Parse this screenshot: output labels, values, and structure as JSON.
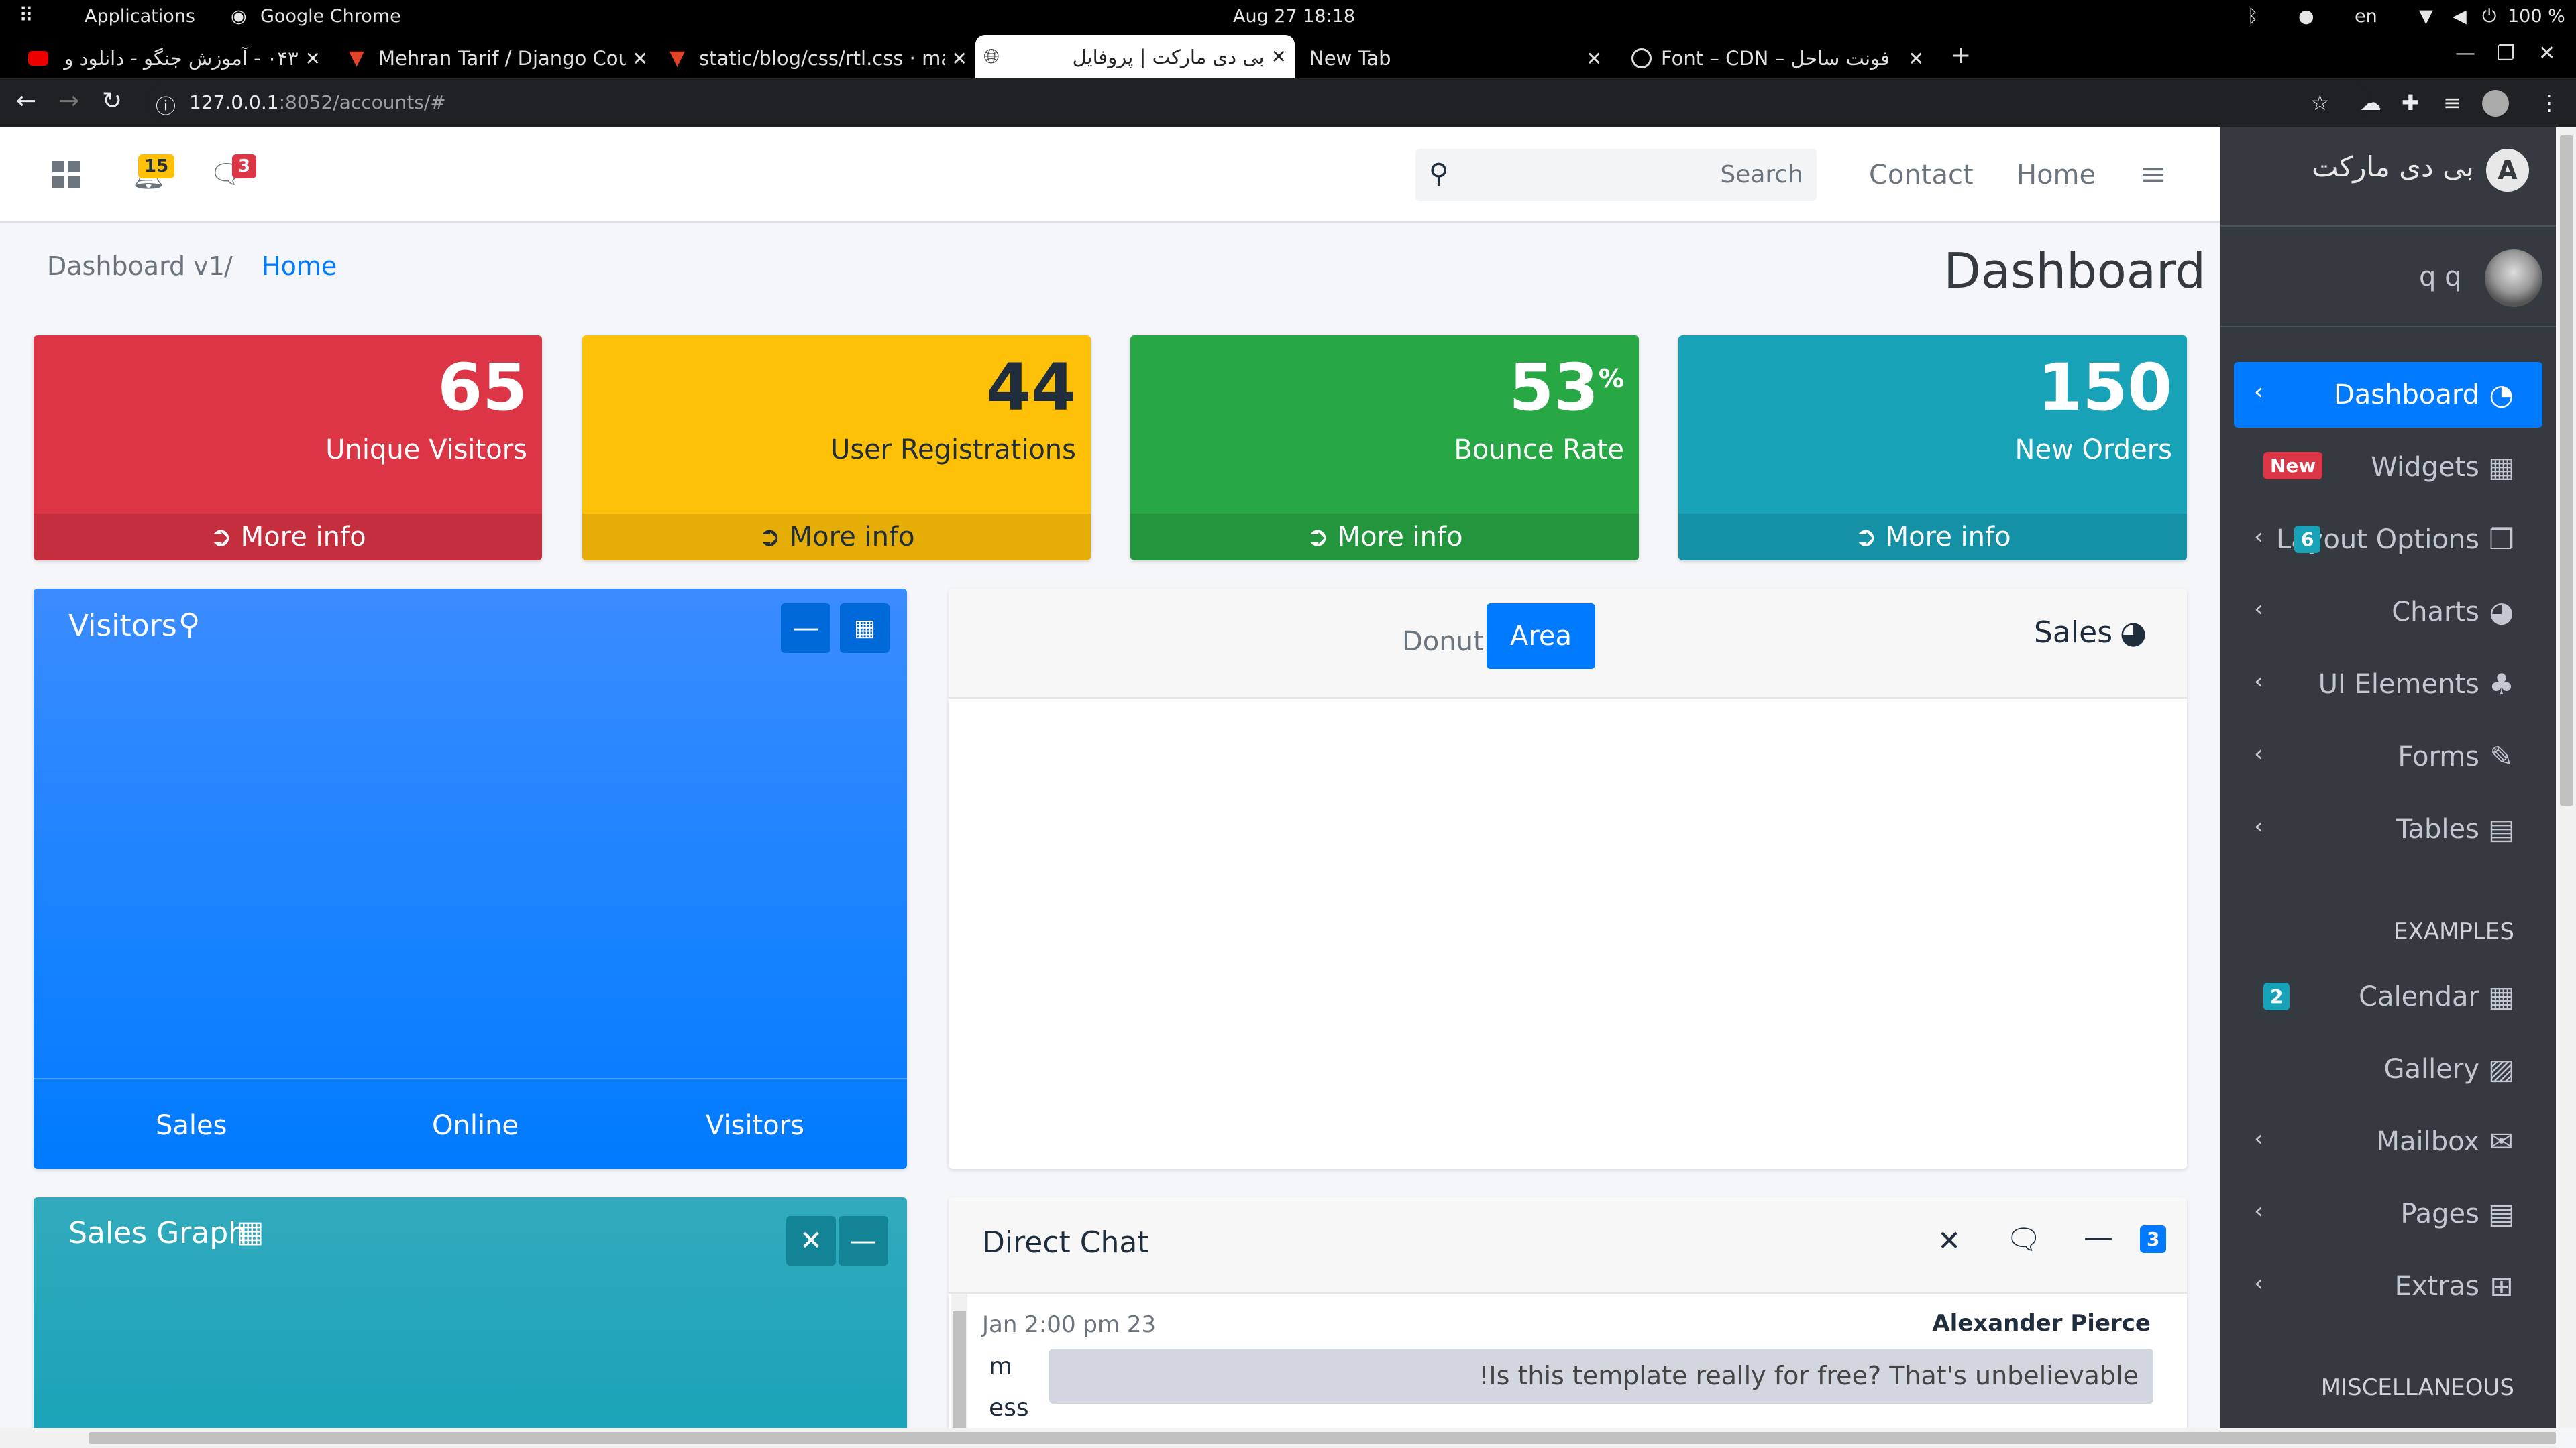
{
  "os": {
    "apps_label": "Applications",
    "browser_label": "Google Chrome",
    "clock": "Aug 27  18:18",
    "lang": "en",
    "battery": "100 %"
  },
  "tabs": [
    {
      "title": "۰۴۳ - آموزش جنگو - دانلود و",
      "icon": "youtube-icon"
    },
    {
      "title": "Mehran Tarif / Django Cou",
      "icon": "gitlab-icon"
    },
    {
      "title": "static/blog/css/rtl.css · ma",
      "icon": "gitlab-icon"
    },
    {
      "title": "بی دی مارکت | پروفایل",
      "icon": "globe-icon",
      "active": true
    },
    {
      "title": "New Tab",
      "icon": ""
    },
    {
      "title": "Font – CDN – فونت ساحل",
      "icon": "wordpress-icon"
    }
  ],
  "address": {
    "host": "127.0.0.1",
    "path": ":8052/accounts/#"
  },
  "navbar": {
    "notifications_count": "15",
    "messages_count": "3",
    "search_placeholder": "Search",
    "links": [
      "Contact",
      "Home"
    ]
  },
  "breadcrumb": {
    "current": "Dashboard v1",
    "separator": "/",
    "home": "Home"
  },
  "page_title": "Dashboard",
  "stat_boxes": [
    {
      "value": "65",
      "suffix": "",
      "label": "Unique Visitors",
      "footer": "More info",
      "color": "#dc3545"
    },
    {
      "value": "44",
      "suffix": "",
      "label": "User Registrations",
      "footer": "More info",
      "color": "#ffc107"
    },
    {
      "value": "53",
      "suffix": "%",
      "label": "Bounce Rate",
      "footer": "More info",
      "color": "#28a745"
    },
    {
      "value": "150",
      "suffix": "",
      "label": "New Orders",
      "footer": "More info",
      "color": "#17a2b8"
    }
  ],
  "visitors_card": {
    "title": "Visitors",
    "footer_labels": [
      "Sales",
      "Online",
      "Visitors"
    ]
  },
  "sales_card": {
    "title": "Sales",
    "tabs": [
      "Donut",
      "Area"
    ],
    "active_tab": "Area"
  },
  "sales_graph_card": {
    "title": "Sales Graph"
  },
  "direct_chat": {
    "title": "Direct Chat",
    "badge": "3",
    "message": {
      "time": "Jan 2:00 pm 23",
      "author": "Alexander Pierce",
      "text": "!Is this template really for free? That's unbelievable",
      "broken_image_alt": "m ess"
    }
  },
  "sidebar": {
    "brand": "بی دی مارکت",
    "user": "q q",
    "items": [
      {
        "label": "Dashboard",
        "icon": "tachometer-icon",
        "active": true,
        "chevron": true
      },
      {
        "label": "Widgets",
        "icon": "th-icon",
        "badge": "New",
        "badge_color": "#dc3545"
      },
      {
        "label": "Layout Options",
        "icon": "copy-icon",
        "chevron": true,
        "badge": "6",
        "badge_color": "#17a2b8"
      },
      {
        "label": "Charts",
        "icon": "pie-chart-icon",
        "chevron": true
      },
      {
        "label": "UI Elements",
        "icon": "tree-icon",
        "chevron": true
      },
      {
        "label": "Forms",
        "icon": "edit-icon",
        "chevron": true
      },
      {
        "label": "Tables",
        "icon": "table-icon",
        "chevron": true
      }
    ],
    "examples_header": "EXAMPLES",
    "examples": [
      {
        "label": "Calendar",
        "icon": "calendar-icon",
        "badge": "2",
        "badge_color": "#17a2b8"
      },
      {
        "label": "Gallery",
        "icon": "image-icon"
      },
      {
        "label": "Mailbox",
        "icon": "envelope-icon",
        "chevron": true
      },
      {
        "label": "Pages",
        "icon": "book-icon",
        "chevron": true
      },
      {
        "label": "Extras",
        "icon": "plus-square-icon",
        "chevron": true
      }
    ],
    "misc_header": "MISCELLANEOUS"
  }
}
